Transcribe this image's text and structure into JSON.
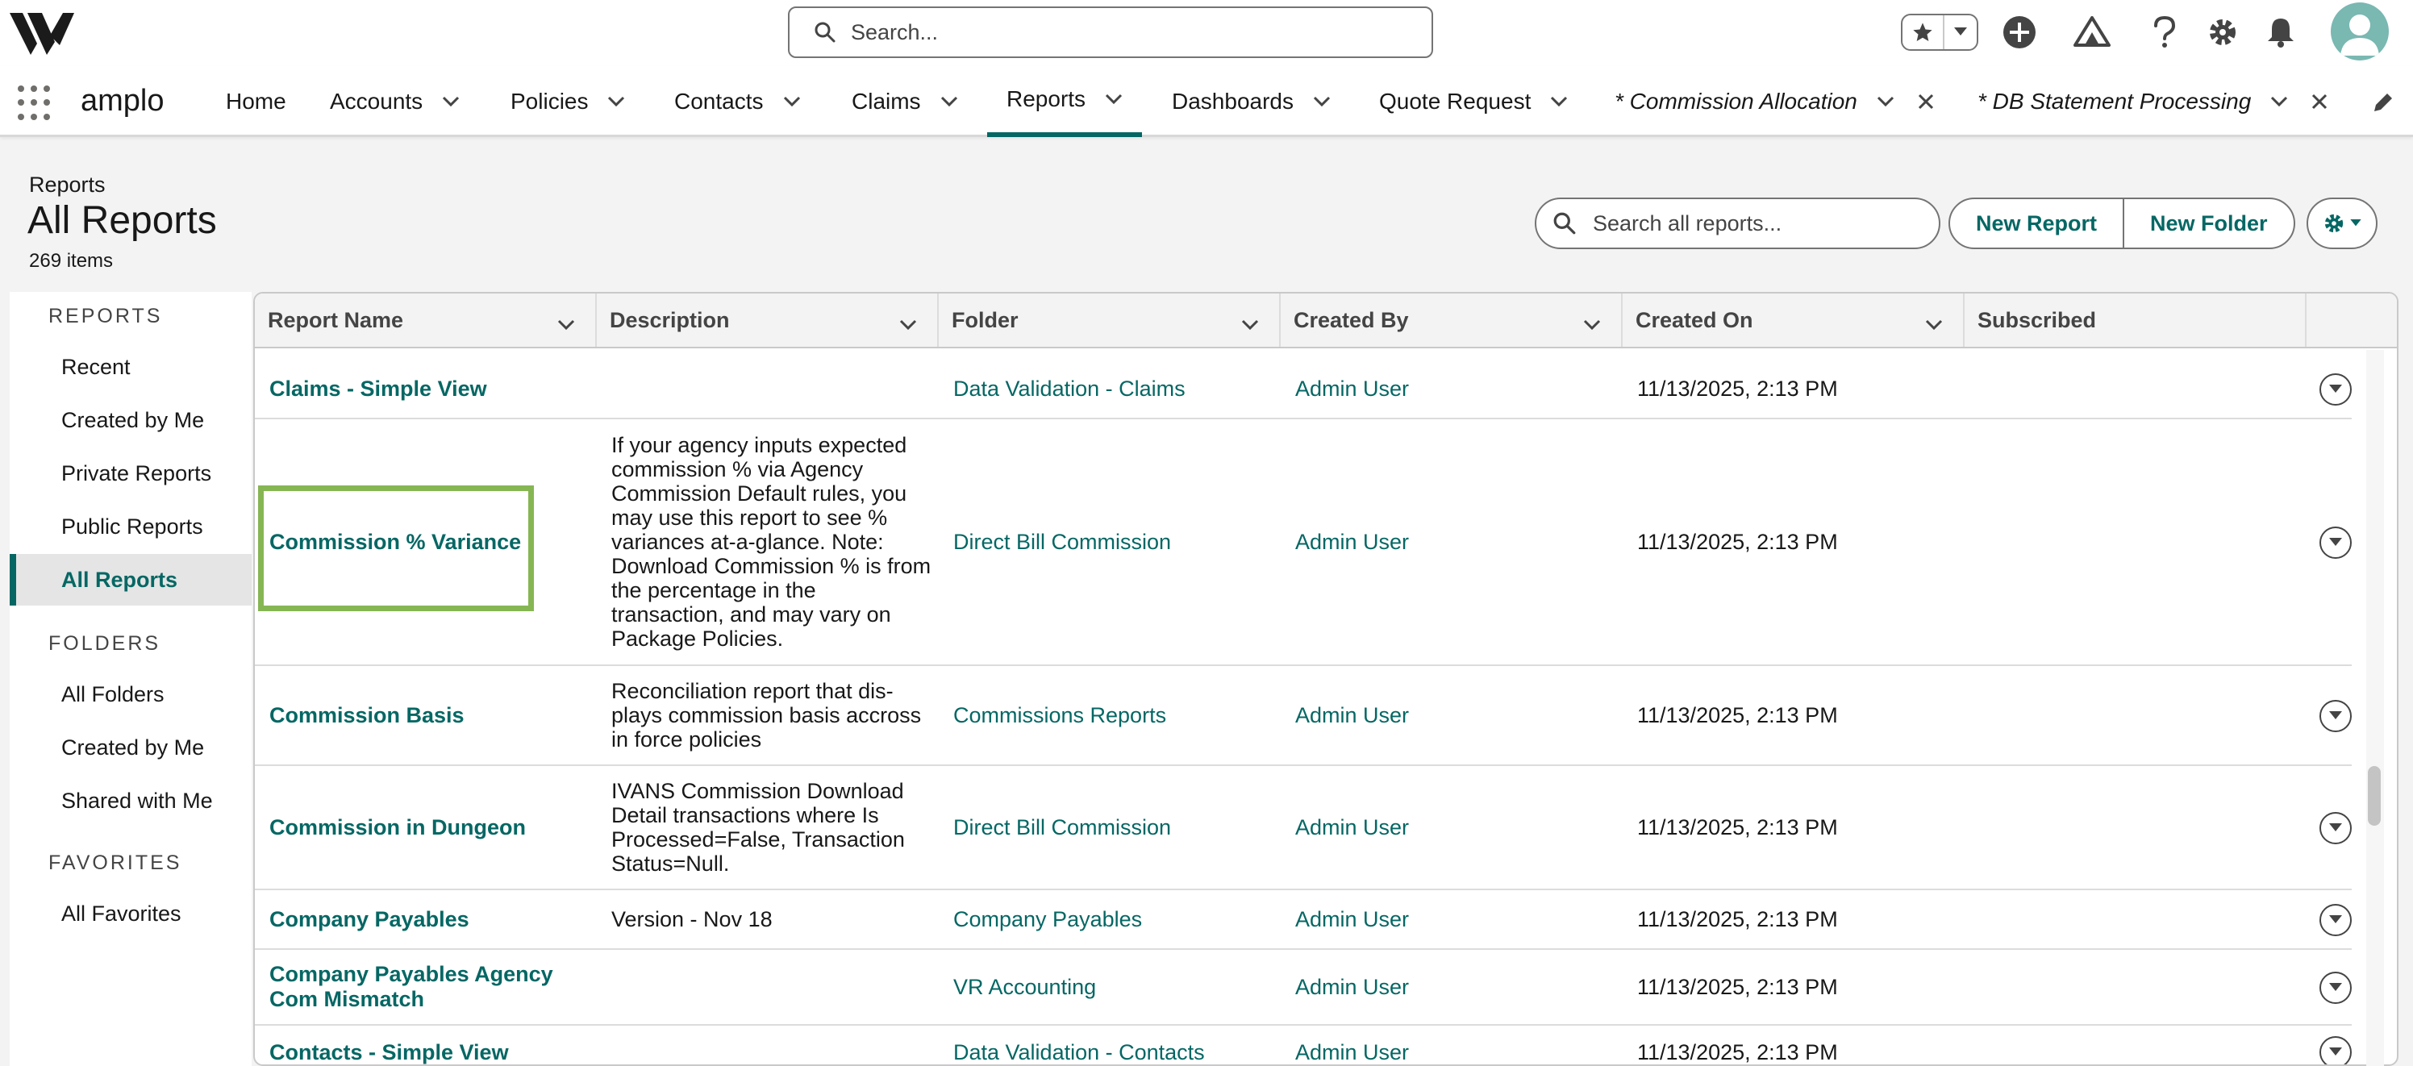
{
  "header": {
    "search_placeholder": "Search..."
  },
  "nav": {
    "app_name": "amplo",
    "items": [
      {
        "label": "Home"
      },
      {
        "label": "Accounts"
      },
      {
        "label": "Policies"
      },
      {
        "label": "Contacts"
      },
      {
        "label": "Claims"
      },
      {
        "label": "Reports"
      },
      {
        "label": "Dashboards"
      },
      {
        "label": "Quote Request"
      },
      {
        "label": "* Commission Allocation"
      },
      {
        "label": "* DB Statement Processing"
      }
    ],
    "active_item": "Reports"
  },
  "page": {
    "breadcrumb": "Reports",
    "title": "All Reports",
    "count": "269 items",
    "search_placeholder": "Search all reports...",
    "new_report": "New Report",
    "new_folder": "New Folder"
  },
  "sidebar": {
    "sections": [
      {
        "heading": "REPORTS",
        "items": [
          "Recent",
          "Created by Me",
          "Private Reports",
          "Public Reports",
          "All Reports"
        ]
      },
      {
        "heading": "FOLDERS",
        "items": [
          "All Folders",
          "Created by Me",
          "Shared with Me"
        ]
      },
      {
        "heading": "FAVORITES",
        "items": [
          "All Favorites"
        ]
      }
    ],
    "active_item": "All Reports"
  },
  "table": {
    "columns": [
      "Report Name",
      "Description",
      "Folder",
      "Created By",
      "Created On",
      "Subscribed"
    ],
    "rows": [
      {
        "name": "Claims - Simple View",
        "description": "",
        "folder": "Data Validation - Claims",
        "created_by": "Admin User",
        "created_on": "11/13/2025, 2:13 PM"
      },
      {
        "name": "Commission % Variance",
        "description": "If your agency inputs expected commission % via Agency Commission Default rules, you may use this report to see % variances at-a-glance. Note: Download Commission % is from the percentage in the transaction, and may vary on Package Policies.",
        "folder": "Direct Bill Commission",
        "created_by": "Admin User",
        "created_on": "11/13/2025, 2:13 PM"
      },
      {
        "name": "Commission Basis",
        "description": "Reconciliation report that dis-plays commission basis accross in force policies",
        "folder": "Commissions Reports",
        "created_by": "Admin User",
        "created_on": "11/13/2025, 2:13 PM"
      },
      {
        "name": "Commission in Dungeon",
        "description": "IVANS Commission Download Detail transactions where Is Processed=False, Transaction Status=Null.",
        "folder": "Direct Bill Commission",
        "created_by": "Admin User",
        "created_on": "11/13/2025, 2:13 PM"
      },
      {
        "name": "Company Payables",
        "description": "Version - Nov 18",
        "folder": "Company Payables",
        "created_by": "Admin User",
        "created_on": "11/13/2025, 2:13 PM"
      },
      {
        "name": "Company Payables Agency Com Mismatch",
        "description": "",
        "folder": "VR Accounting",
        "created_by": "Admin User",
        "created_on": "11/13/2025, 2:13 PM"
      },
      {
        "name": "Contacts - Simple View",
        "description": "",
        "folder": "Data Validation - Contacts",
        "created_by": "Admin User",
        "created_on": "11/13/2025, 2:13 PM"
      }
    ]
  },
  "colors": {
    "accent": "#056764",
    "highlight": "#86b653"
  }
}
